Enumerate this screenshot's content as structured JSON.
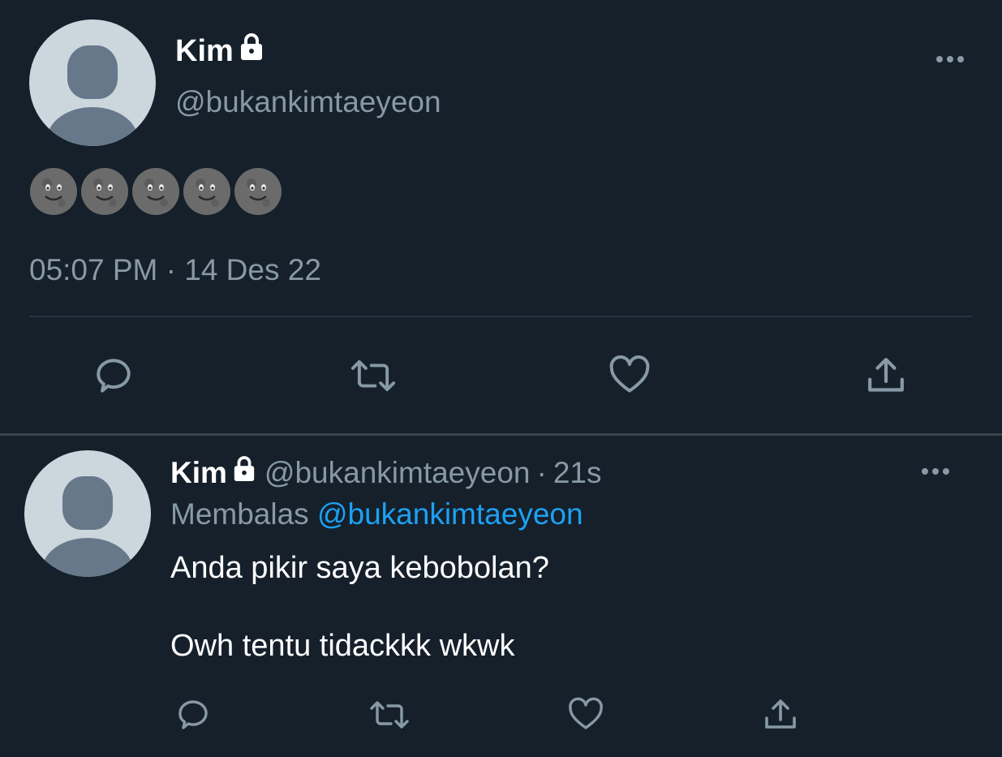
{
  "main_tweet": {
    "display_name": "Kim",
    "handle": "@bukankimtaeyeon",
    "content_emoji": [
      "moon-face",
      "moon-face",
      "moon-face",
      "moon-face",
      "moon-face"
    ],
    "timestamp": "05:07 PM · 14 Des 22",
    "actions": [
      "reply-icon",
      "retweet-icon",
      "like-icon",
      "share-icon"
    ]
  },
  "reply_tweet": {
    "display_name": "Kim",
    "handle": "@bukankimtaeyeon",
    "separator": "·",
    "time_ago": "21s",
    "replying_label": "Membalas",
    "replying_to": "@bukankimtaeyeon",
    "text_line1": "Anda pikir saya kebobolan?",
    "text_line2": "Owh tentu tidackkk wkwk",
    "actions": [
      "reply-icon",
      "retweet-icon",
      "like-icon",
      "share-icon"
    ]
  },
  "colors": {
    "background": "#15202b",
    "secondary_text": "#8899a6",
    "accent": "#1da1f2",
    "divider": "#38444d"
  }
}
